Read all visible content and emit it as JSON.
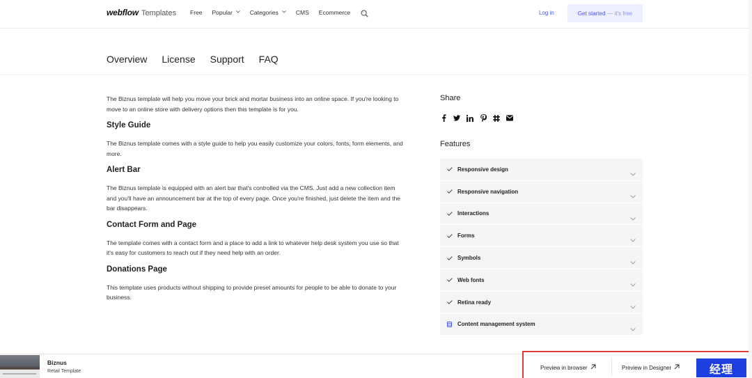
{
  "header": {
    "logo_brand": "webflow",
    "logo_suffix": "Templates",
    "nav": [
      {
        "label": "Free",
        "caret": false
      },
      {
        "label": "Popular",
        "caret": true
      },
      {
        "label": "Categories",
        "caret": true
      },
      {
        "label": "CMS",
        "caret": false
      },
      {
        "label": "Ecommerce",
        "caret": false
      }
    ],
    "login": "Log in",
    "cta_main": "Get started",
    "cta_sub": "— it's free"
  },
  "tabs": [
    "Overview",
    "License",
    "Support",
    "FAQ"
  ],
  "content": {
    "intro": "The Biznus template will help you move your brick and mortar business into an online space. If you're looking to move to an online store with delivery options then this template is for you.",
    "sections": [
      {
        "heading": "Style Guide",
        "text": "The Biznus template comes with a style guide to help you easily customize your colors, fonts, form elements, and more."
      },
      {
        "heading": "Alert Bar",
        "text": "The Biznus template is equipped with an alert bar that's controlled via the CMS. Just add a new collection item and you'll have an announcement bar at the top of every page. Once you're finished, just delete the item and the bar disappears."
      },
      {
        "heading": "Contact Form and Page",
        "text": "The template comes with a contact form and a place to add a link to whatever help desk system you use so that it's easy for customers to reach out if they need help with an order."
      },
      {
        "heading": "Donations Page",
        "text": "This template uses products without shipping to provide preset amounts for people to be able to donate to your business."
      }
    ]
  },
  "sidebar": {
    "share_title": "Share",
    "share_icons": [
      "facebook-icon",
      "twitter-icon",
      "linkedin-icon",
      "pinterest-icon",
      "slack-icon",
      "email-icon"
    ],
    "features_title": "Features",
    "features": [
      {
        "label": "Responsive design",
        "icon": "check"
      },
      {
        "label": "Responsive navigation",
        "icon": "check"
      },
      {
        "label": "Interactions",
        "icon": "check"
      },
      {
        "label": "Forms",
        "icon": "check"
      },
      {
        "label": "Symbols",
        "icon": "check"
      },
      {
        "label": "Web fonts",
        "icon": "check"
      },
      {
        "label": "Retina ready",
        "icon": "check"
      },
      {
        "label": "Content management system",
        "icon": "database"
      }
    ]
  },
  "bottom_bar": {
    "template_name": "Biznus",
    "template_type": "Retail Template",
    "preview_label": "Preview in browser",
    "designer_label": "Preview in Designer",
    "stamp_text": "经理"
  },
  "colors": {
    "accent": "#4353ff",
    "cta_bg": "#eef0ff",
    "feature_bg": "#f5f5f7",
    "highlight": "#e03a3a"
  }
}
